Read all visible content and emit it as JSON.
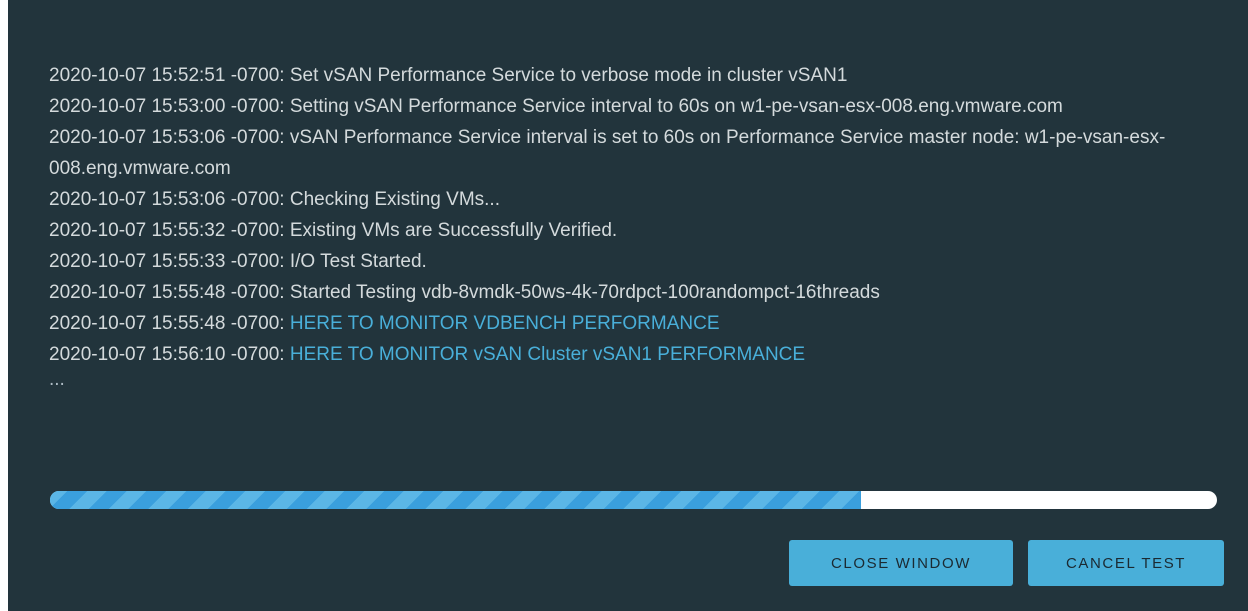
{
  "log": {
    "lines": [
      {
        "text": "2020-10-07 15:52:51 -0700: Set vSAN Performance Service to verbose mode in cluster vSAN1"
      },
      {
        "text": "2020-10-07 15:53:00 -0700: Setting vSAN Performance Service interval to 60s on w1-pe-vsan-esx-008.eng.vmware.com"
      },
      {
        "text": "2020-10-07 15:53:06 -0700: vSAN Performance Service interval is set to 60s on Performance Service master node: w1-pe-vsan-esx-008.eng.vmware.com"
      },
      {
        "text": "2020-10-07 15:53:06 -0700: Checking Existing VMs..."
      },
      {
        "text": "2020-10-07 15:55:32 -0700: Existing VMs are Successfully Verified."
      },
      {
        "text": "2020-10-07 15:55:33 -0700: I/O Test Started."
      },
      {
        "text": "2020-10-07 15:55:48 -0700: Started Testing vdb-8vmdk-50ws-4k-70rdpct-100randompct-16threads"
      },
      {
        "prefix": "2020-10-07 15:55:48 -0700: ",
        "link": "HERE TO MONITOR VDBENCH PERFORMANCE"
      },
      {
        "prefix": "2020-10-07 15:56:10 -0700: ",
        "link": "HERE TO MONITOR vSAN Cluster vSAN1 PERFORMANCE"
      }
    ],
    "ellipsis": "..."
  },
  "progress": {
    "fraction": 0.695,
    "fill_color": "#49afd9",
    "track_color": "#ffffff"
  },
  "buttons": {
    "close_label": "CLOSE WINDOW",
    "cancel_label": "CANCEL TEST"
  },
  "colors": {
    "background": "#22343c",
    "text": "#d4dadc",
    "link": "#49afd9",
    "button": "#49afd9"
  }
}
